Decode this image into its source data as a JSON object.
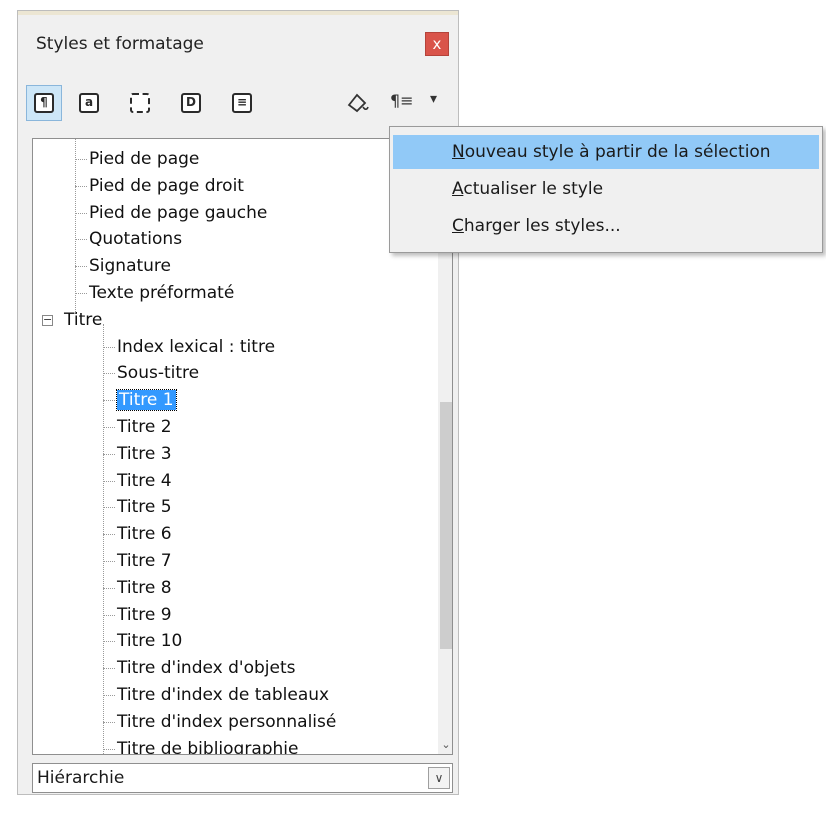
{
  "panel": {
    "title": "Styles et formatage",
    "close_label": "x",
    "toolbar": {
      "buttons": [
        {
          "name": "paragraph-styles-icon",
          "glyph": "¶",
          "active": true
        },
        {
          "name": "character-styles-icon",
          "glyph": "a",
          "active": false
        },
        {
          "name": "frame-styles-icon",
          "glyph": "",
          "active": false
        },
        {
          "name": "page-styles-icon",
          "glyph": "D",
          "active": false
        },
        {
          "name": "list-styles-icon",
          "glyph": "≡",
          "active": false
        }
      ],
      "fill_format_glyph": "🪣",
      "new_style_glyph": "¶≡",
      "dropdown_glyph": "▾"
    }
  },
  "tree": {
    "items": [
      {
        "label": "Pied de page",
        "level": 1
      },
      {
        "label": "Pied de page droit",
        "level": 1
      },
      {
        "label": "Pied de page gauche",
        "level": 1
      },
      {
        "label": "Quotations",
        "level": 1
      },
      {
        "label": "Signature",
        "level": 1
      },
      {
        "label": "Texte préformaté",
        "level": 1
      },
      {
        "label": "Titre",
        "level": 0,
        "expanded": true
      },
      {
        "label": "Index lexical : titre",
        "level": 2
      },
      {
        "label": "Sous-titre",
        "level": 2
      },
      {
        "label": "Titre 1",
        "level": 2,
        "selected": true
      },
      {
        "label": "Titre 2",
        "level": 2
      },
      {
        "label": "Titre 3",
        "level": 2
      },
      {
        "label": "Titre 4",
        "level": 2
      },
      {
        "label": "Titre 5",
        "level": 2
      },
      {
        "label": "Titre 6",
        "level": 2
      },
      {
        "label": "Titre 7",
        "level": 2
      },
      {
        "label": "Titre 8",
        "level": 2
      },
      {
        "label": "Titre 9",
        "level": 2
      },
      {
        "label": "Titre 10",
        "level": 2
      },
      {
        "label": "Titre d'index d'objets",
        "level": 2
      },
      {
        "label": "Titre d'index de tableaux",
        "level": 2
      },
      {
        "label": "Titre d'index personnalisé",
        "level": 2
      },
      {
        "label": "Titre de bibliographie",
        "level": 2
      }
    ],
    "expander_glyph": "−",
    "scroll_down_glyph": "⌄"
  },
  "filter": {
    "value": "Hiérarchie",
    "button_glyph": "∨"
  },
  "menu": {
    "items": [
      {
        "accel": "N",
        "rest": "ouveau style à partir de la sélection",
        "highlighted": true
      },
      {
        "accel": "A",
        "rest": "ctualiser le style",
        "highlighted": false
      },
      {
        "accel": "C",
        "rest": "harger les styles...",
        "highlighted": false
      }
    ]
  },
  "colors": {
    "selection": "#3399ff",
    "menu_highlight": "#91c9f7",
    "close_button": "#d9544a"
  }
}
